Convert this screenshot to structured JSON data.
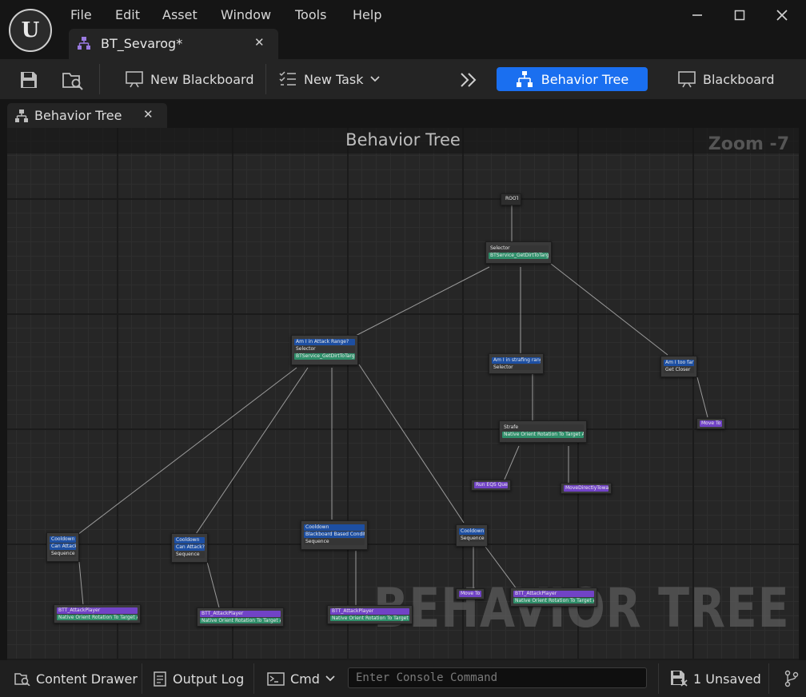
{
  "menu": {
    "file": "File",
    "edit": "Edit",
    "asset": "Asset",
    "window": "Window",
    "tools": "Tools",
    "help": "Help"
  },
  "document_tab": {
    "label": "BT_Sevarog*"
  },
  "toolbar": {
    "new_blackboard": "New Blackboard",
    "new_task": "New Task",
    "behavior_tree": "Behavior Tree",
    "blackboard": "Blackboard"
  },
  "panel_tab": {
    "label": "Behavior Tree"
  },
  "graph": {
    "title": "Behavior Tree",
    "zoom": "Zoom -7",
    "watermark": "BEHAVIOR TREE",
    "nodes": {
      "root": {
        "label": "ROOT"
      },
      "main_selector": {
        "composite": "Selector",
        "service": "BTService_GetDirtToTarget"
      },
      "attack_selector": {
        "decorator": "Am I in Attack Range?",
        "composite": "Selector",
        "service": "BTService_GetDirtToTarget"
      },
      "strafe_selector": {
        "decorator": "Am I in strafing range?",
        "composite": "Selector"
      },
      "far_node": {
        "decorator": "Am I too far?",
        "composite": "Get Closer"
      },
      "move_to_far": {
        "task": "Move To"
      },
      "strafe": {
        "composite": "Strafe",
        "service": "Native Orient Rotation To Target Actor"
      },
      "run_eqs": {
        "task": "Run EQS Query"
      },
      "move_directly": {
        "task": "MoveDirectlyToward"
      },
      "seq1": {
        "dec1": "Cooldown",
        "dec2": "Can Attack",
        "composite": "Sequence"
      },
      "seq2": {
        "dec1": "Cooldown",
        "dec2": "Can Attack?",
        "composite": "Sequence"
      },
      "seq3": {
        "dec1": "Cooldown",
        "dec2": "Blackboard Based Condition",
        "composite": "Sequence"
      },
      "seq4": {
        "dec1": "Cooldown",
        "composite": "Sequence"
      },
      "attack1": {
        "task": "BTT_AttackPlayer",
        "service": "Native Orient Rotation To Target Actor"
      },
      "attack2": {
        "task": "BTT_AttackPlayer",
        "service": "Native Orient Rotation To Target Actor"
      },
      "attack3": {
        "task": "BTT_AttackPlayer",
        "service": "Native Orient Rotation To Target Actor"
      },
      "move_to_seq4": {
        "task": "Move To"
      },
      "attack4": {
        "task": "BTT_AttackPlayer",
        "service": "Native Orient Rotation To Target Actor"
      }
    }
  },
  "statusbar": {
    "content_drawer": "Content Drawer",
    "output_log": "Output Log",
    "cmd": "Cmd",
    "console_placeholder": "Enter Console Command",
    "unsaved": "1 Unsaved"
  },
  "colors": {
    "accent": "#1a6ff0",
    "decorator": "#1d4fa2",
    "service": "#2f8f6a",
    "task": "#7143c6"
  }
}
